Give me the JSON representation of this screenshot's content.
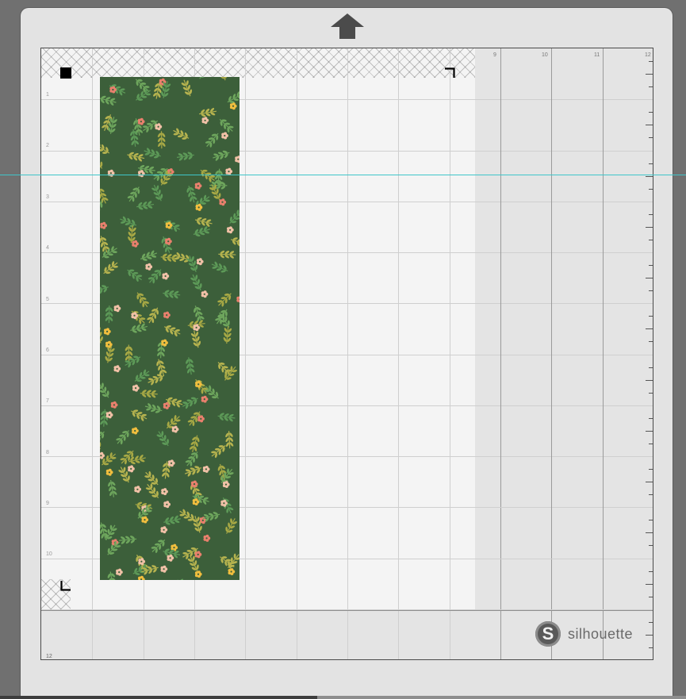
{
  "mat": {
    "column_labels": [
      "9",
      "10",
      "11",
      "12"
    ],
    "row_labels": [
      "1",
      "2",
      "3",
      "4",
      "5",
      "6",
      "7",
      "8",
      "9",
      "10",
      "12"
    ],
    "grid_inches": 12,
    "cut_area_inches": {
      "width": 8.5,
      "height": 11
    }
  },
  "design": {
    "name": "floral-pattern-rectangle",
    "background_color": "#3c5f3a",
    "flower_colors": [
      "#e9806d",
      "#f1c1a7",
      "#f1be3e",
      "#b6b34f",
      "#5d9a58"
    ]
  },
  "brand": {
    "name": "silhouette",
    "logo_letter": "S"
  },
  "icons": [
    "mat-load-arrow-icon",
    "registration-mark-icon",
    "silhouette-logo-icon"
  ],
  "colors": {
    "guide_line": "#3fc5c9",
    "mat_frame": "#e3e3e3",
    "cut_area": "#f4f4f4",
    "outside_area": "#e4e4e4"
  }
}
